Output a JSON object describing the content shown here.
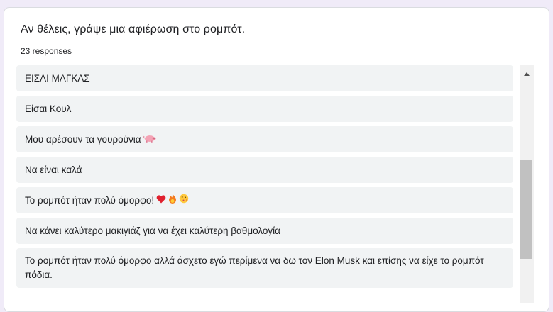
{
  "question": {
    "title": "Αν θέλεις, γράψε μια αφιέρωση στο ρομπότ.",
    "responses_count": "23 responses"
  },
  "responses": [
    "ΕΙΣΑΙ ΜΑΓΚΑΣ",
    "Είσαι Κουλ",
    "Μου αρέσουν τα γουρούνια",
    "Να είναι καλά",
    "Το ρομπότ ήταν πολύ όμορφο!",
    "Να κάνει καλύτερο μακιγιάζ για να έχει καλύτερη βαθμολογία",
    "Το ρομπότ ήταν πολύ όμορφο αλλά άσχετο εγώ περίμενα να δω τον Elon Musk και επίσης να είχε το ρομπότ πόδια."
  ],
  "icons": {
    "pig": "pig-icon",
    "heart": "heart-icon",
    "fire": "fire-icon",
    "kiss": "kissing-face-icon",
    "scroll_up": "scroll-up-arrow-icon"
  },
  "colors": {
    "background": "#f0ebf8",
    "card": "#ffffff",
    "item_bg": "#f1f3f4",
    "text": "#202124"
  }
}
